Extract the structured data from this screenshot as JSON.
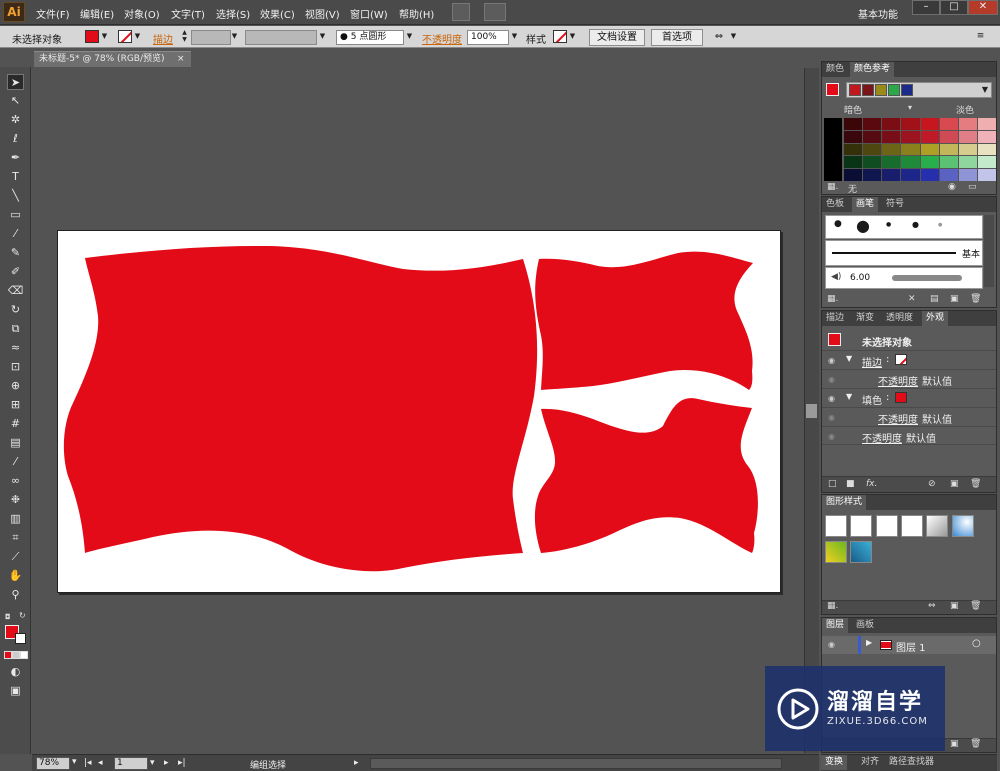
{
  "menubar": {
    "logo": "Ai",
    "items": [
      "文件(F)",
      "编辑(E)",
      "对象(O)",
      "文字(T)",
      "选择(S)",
      "效果(C)",
      "视图(V)",
      "窗口(W)",
      "帮助(H)"
    ],
    "workspace": "基本功能",
    "window_buttons": [
      "–",
      "□",
      "✕"
    ]
  },
  "control": {
    "selection_status": "未选择对象",
    "stroke_label": "描边",
    "brush_value": "5",
    "brush_shape": "点圆形",
    "opacity_label": "不透明度",
    "opacity_value": "100%",
    "style_label": "样式",
    "doc_setup": "文档设置",
    "preferences": "首选项"
  },
  "document_tab": {
    "title": "未标题-5* @ 78% (RGB/预览)",
    "close": "×"
  },
  "status": {
    "zoom": "78%",
    "page": "1",
    "tool": "编组选择"
  },
  "panels": {
    "color": {
      "tabs": [
        "颜色",
        "颜色参考"
      ],
      "dark_label": "暗色",
      "light_label": "淡色",
      "none_label": "无",
      "harmony_colors": [
        "#c0181e",
        "#7a1418",
        "#9a8a1a",
        "#2aa84a",
        "#1c2a8a"
      ],
      "shade_grid": [
        [
          "#3a0608",
          "#5a0a0e",
          "#7a0e14",
          "#a01218",
          "#c8161e",
          "#d84a50",
          "#e47c80",
          "#efafb1"
        ],
        [
          "#3a070c",
          "#560a12",
          "#780e18",
          "#9c1420",
          "#c01a28",
          "#d04a56",
          "#e07e88",
          "#eeb2b8"
        ],
        [
          "#34300a",
          "#4e4810",
          "#6c6416",
          "#8a801c",
          "#aea024",
          "#c2b65a",
          "#d6cc8e",
          "#e8e2c0"
        ],
        [
          "#0a3416",
          "#104e22",
          "#186c2e",
          "#1e8a3a",
          "#28ae4a",
          "#5ac272",
          "#8ed69e",
          "#c2eacb"
        ],
        [
          "#0a0e34",
          "#10164e",
          "#181e6c",
          "#1e268a",
          "#2630ae",
          "#5a62c2",
          "#8e94d6",
          "#c2c4ea"
        ]
      ]
    },
    "brush": {
      "tabs": [
        "色板",
        "画笔",
        "符号"
      ],
      "basic_label": "基本",
      "size_value": "6.00"
    },
    "appearance": {
      "tabs": [
        "描边",
        "渐变",
        "透明度",
        "外观"
      ],
      "title": "未选择对象",
      "stroke_label": "描边",
      "opacity_label": "不透明度",
      "default_label": "默认值",
      "fill_label": "填色",
      "fx_label": "fx."
    },
    "graphic_styles": {
      "tabs": [
        "图形样式"
      ]
    },
    "layers": {
      "tabs": [
        "图层",
        "画板"
      ],
      "layer_name": "图层 1"
    },
    "bottom_tabs": [
      "变换",
      "对齐",
      "路径查找器"
    ]
  },
  "watermark": {
    "brand": "溜溜自学",
    "url": "ZIXUE.3D66.COM"
  },
  "colors": {
    "flag_red": "#e30b17",
    "accent_orange": "#c8640a"
  }
}
